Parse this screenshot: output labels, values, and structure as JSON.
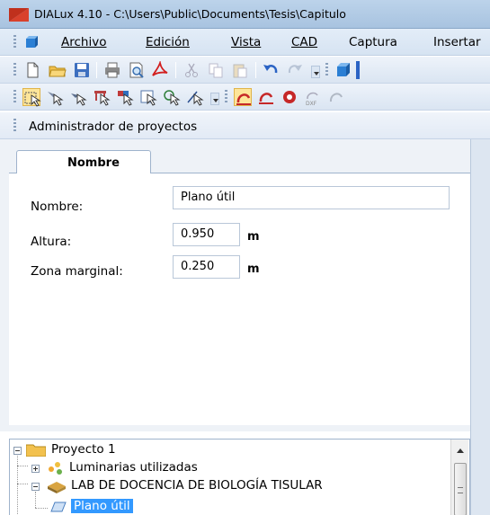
{
  "window": {
    "title": "DIALux 4.10 - C:\\Users\\Public\\Documents\\Tesis\\Capitulo"
  },
  "menu": {
    "items": [
      {
        "label": "Archivo"
      },
      {
        "label": "Edición"
      },
      {
        "label": "Vista"
      },
      {
        "label": "CAD"
      },
      {
        "label": "Captura"
      },
      {
        "label": "Insertar"
      }
    ]
  },
  "toolbar1": {
    "icons": [
      "new-file-icon",
      "open-folder-icon",
      "save-icon",
      "print-icon",
      "print-preview-icon",
      "pdf-icon",
      "cut-icon",
      "copy-icon",
      "paste-icon",
      "undo-icon",
      "redo-icon",
      "overflow-icon",
      "3d-view-icon"
    ]
  },
  "toolbar2": {
    "icons": [
      "select-icon",
      "select-luminaire-icon",
      "select-arrow-icon",
      "select-furniture-icon",
      "select-group-icon",
      "select-area-icon",
      "select-calc-icon",
      "select-measure-icon",
      "overflow-icon",
      "tape-red-icon",
      "tape-red-2-icon",
      "tape-red-3-icon",
      "dxf-icon",
      "tape-gray-icon"
    ]
  },
  "panel": {
    "title": "Administrador de proyectos"
  },
  "properties": {
    "tab_label": "Nombre",
    "fields": {
      "nombre_label": "Nombre:",
      "nombre_value": "Plano útil",
      "altura_label": "Altura:",
      "altura_value": "0.950",
      "altura_unit": "m",
      "zona_label": "Zona marginal:",
      "zona_value": "0.250",
      "zona_unit": "m"
    }
  },
  "tree": {
    "items": [
      {
        "label": "Proyecto 1"
      },
      {
        "label": "Luminarias utilizadas"
      },
      {
        "label": "LAB DE DOCENCIA DE BIOLOGÍA TISULAR"
      },
      {
        "label": "Plano útil"
      }
    ]
  },
  "colors": {
    "selection": "#3399ff",
    "titlebar": "#bcd3ea",
    "logo": "#d9412c"
  }
}
